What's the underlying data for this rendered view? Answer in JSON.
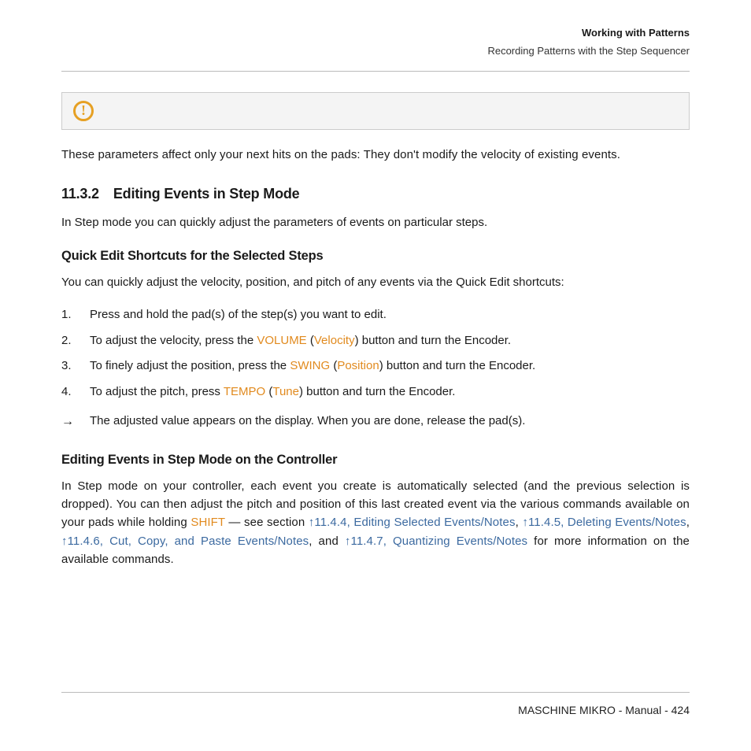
{
  "header": {
    "title": "Working with Patterns",
    "subtitle": "Recording Patterns with the Step Sequencer"
  },
  "alert_icon_glyph": "!",
  "intro_para": "These parameters affect only your next hits on the pads: They don't modify the velocity of existing events.",
  "section": {
    "number": "11.3.2",
    "title": "Editing Events in Step Mode"
  },
  "section_intro": "In Step mode you can quickly adjust the parameters of events on particular steps.",
  "sub1_title": "Quick Edit Shortcuts for the Selected Steps",
  "sub1_intro": "You can quickly adjust the velocity, position, and pitch of any events via the Quick Edit shortcuts:",
  "steps": {
    "s1": {
      "num": "1.",
      "text": "Press and hold the pad(s) of the step(s) you want to edit."
    },
    "s2": {
      "num": "2.",
      "pre": "To adjust the velocity, press the ",
      "kw1": "VOLUME",
      "mid": " (",
      "kw2": "Velocity",
      "post": ") button and turn the Encoder."
    },
    "s3": {
      "num": "3.",
      "pre": "To finely adjust the position, press the ",
      "kw1": "SWING",
      "mid": " (",
      "kw2": "Position",
      "post": ") button and turn the Encoder."
    },
    "s4": {
      "num": "4.",
      "pre": "To adjust the pitch, press ",
      "kw1": "TEMPO",
      "mid": " (",
      "kw2": "Tune",
      "post": ") button and turn the Encoder."
    }
  },
  "arrow_glyph": "→",
  "arrow_text": "The adjusted value appears on the display. When you are done, release the pad(s).",
  "sub2_title": "Editing Events in Step Mode on the Controller",
  "sub2": {
    "pre": "In Step mode on your controller, each event you create is automatically selected (and the previous selection is dropped). You can then adjust the pitch and position of this last created event via the various commands available on your pads while holding ",
    "kw_shift": "SHIFT",
    "mid1": " — see section ",
    "link1": "↑11.4.4, Editing Selected Events/Notes",
    "sep1": ", ",
    "link2": "↑11.4.5, Deleting Events/Notes",
    "sep2": ", ",
    "link3": "↑11.4.6, Cut, Copy, and Paste Events/Notes",
    "sep3": ", and ",
    "link4": "↑11.4.7, Quantizing Events/Notes",
    "post": " for more information on the available commands."
  },
  "footer": "MASCHINE MIKRO - Manual - 424"
}
